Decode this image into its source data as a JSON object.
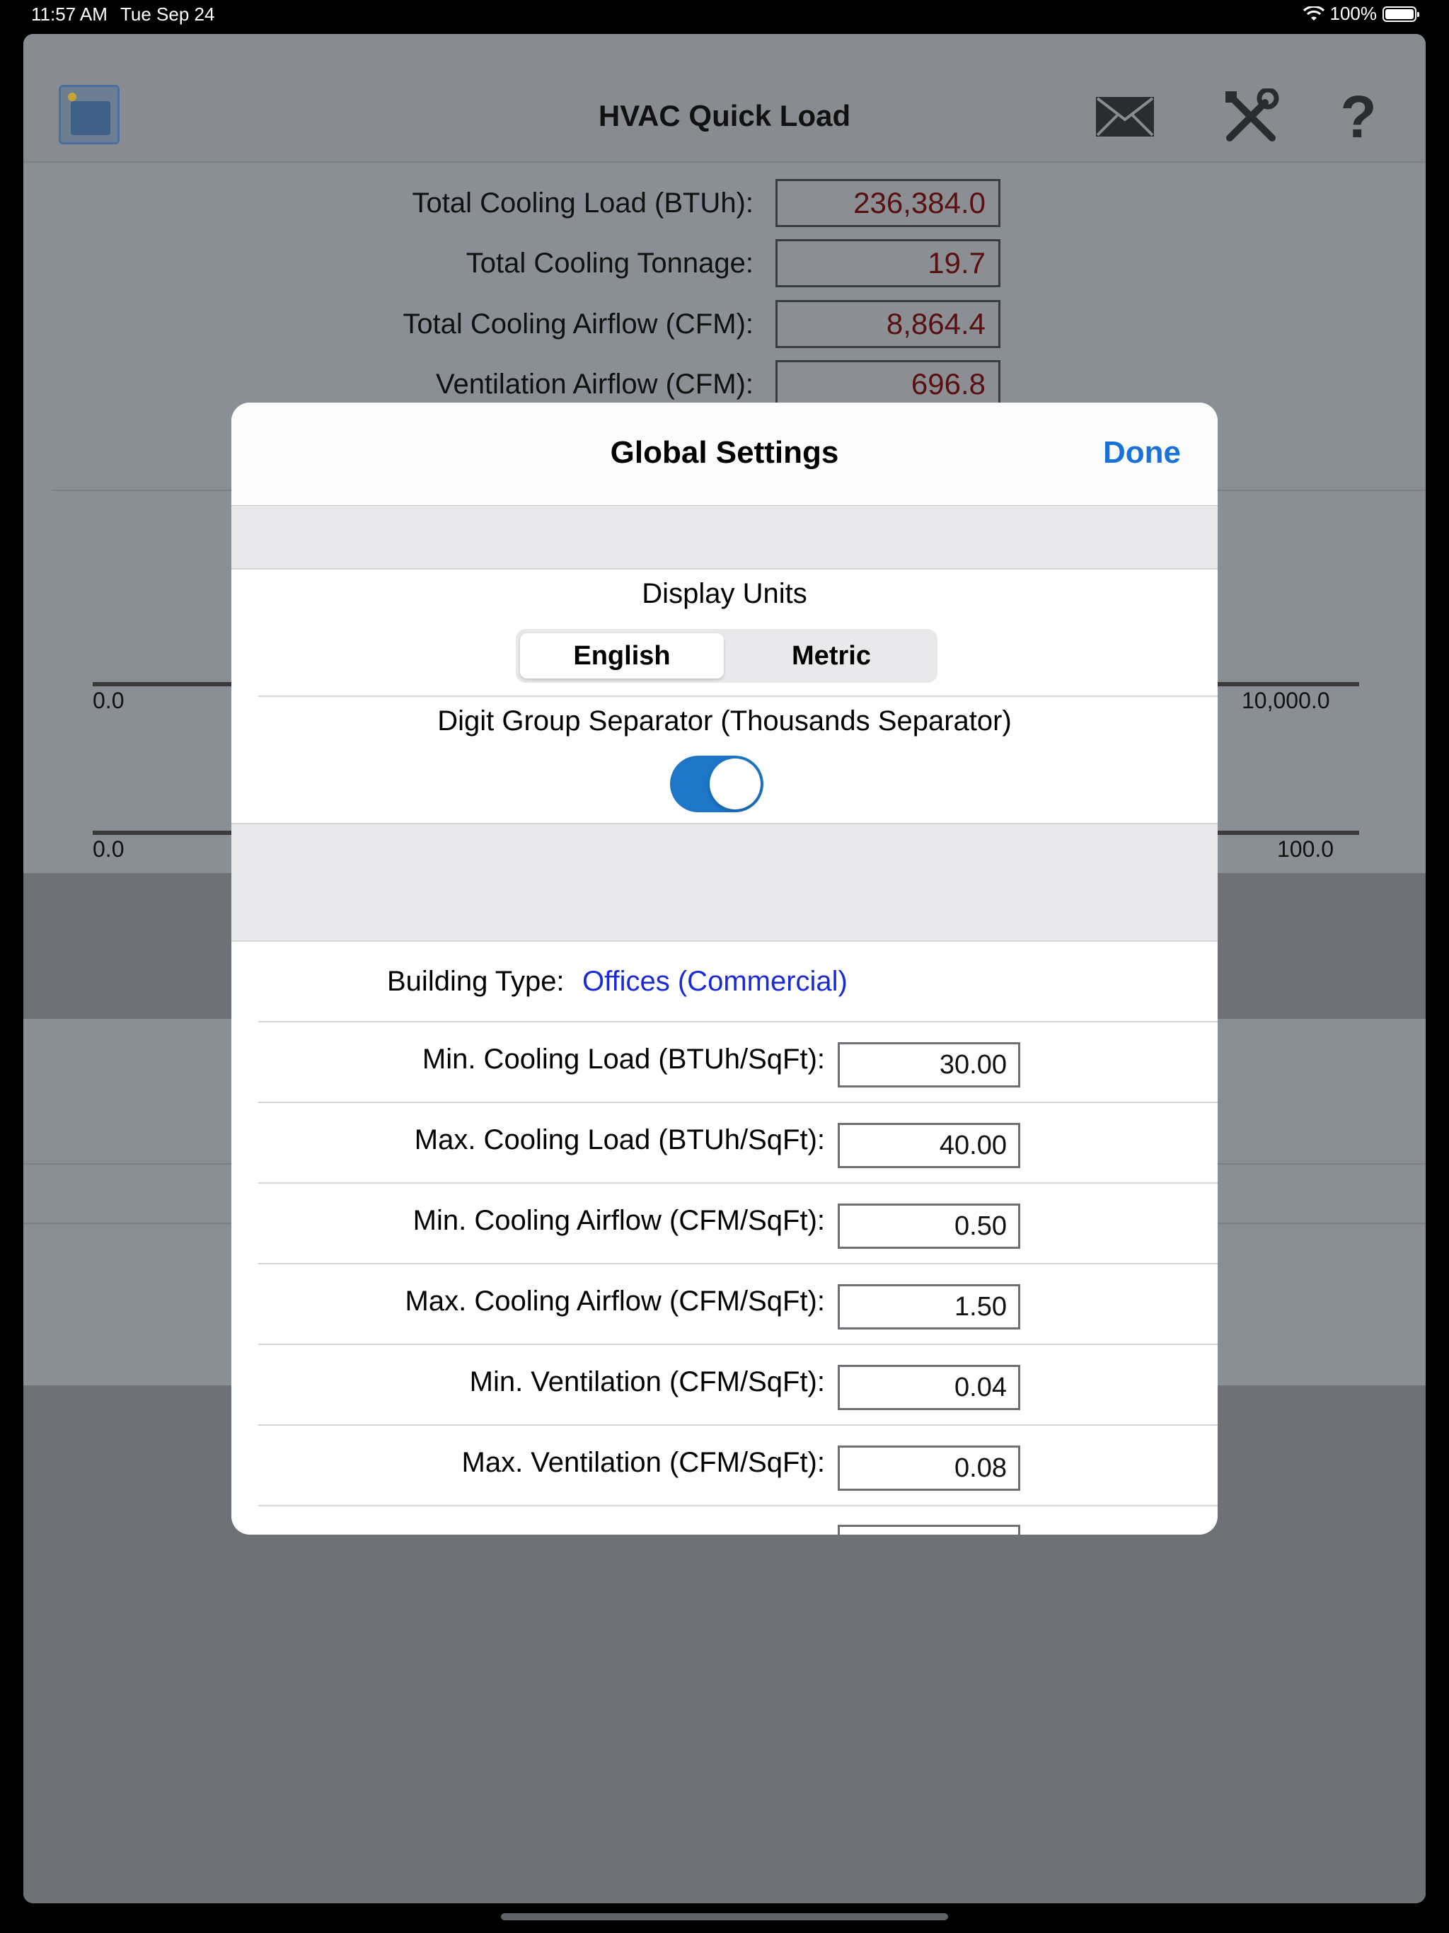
{
  "status_bar": {
    "time": "11:57 AM",
    "date": "Tue Sep 24",
    "battery": "100%"
  },
  "app": {
    "title": "HVAC Quick Load",
    "icons": {
      "logo": "building-icon",
      "mail": "mail-icon",
      "settings": "tools-icon",
      "help": "help-icon"
    },
    "results": [
      {
        "label": "Total Cooling Load (BTUh):",
        "value": "236,384.0"
      },
      {
        "label": "Total Cooling Tonnage:",
        "value": "19.7"
      },
      {
        "label": "Total Cooling Airflow (CFM):",
        "value": "8,864.4"
      },
      {
        "label": "Ventilation Airflow (CFM):",
        "value": "696.8"
      }
    ],
    "slider1": {
      "min": "0.0",
      "max": "10,000.0"
    },
    "slider2": {
      "min": "0.0",
      "max": "100.0"
    }
  },
  "modal": {
    "title": "Global Settings",
    "done_label": "Done",
    "display_units": {
      "label": "Display Units",
      "options": [
        "English",
        "Metric"
      ],
      "selected": "English"
    },
    "digit_separator": {
      "label": "Digit Group Separator (Thousands Separator)",
      "enabled": true
    },
    "building_type": {
      "label": "Building Type:",
      "value": "Offices (Commercial)"
    },
    "settings": [
      {
        "label": "Min. Cooling Load (BTUh/SqFt):",
        "value": "30.00"
      },
      {
        "label": "Max. Cooling Load (BTUh/SqFt):",
        "value": "40.00"
      },
      {
        "label": "Min. Cooling Airflow (CFM/SqFt):",
        "value": "0.50"
      },
      {
        "label": "Max. Cooling Airflow (CFM/SqFt):",
        "value": "1.50"
      },
      {
        "label": "Min. Ventilation (CFM/SqFt):",
        "value": "0.04"
      },
      {
        "label": "Max. Ventilation (CFM/SqFt):",
        "value": "0.08"
      }
    ]
  },
  "colors": {
    "accent": "#1a72d8",
    "link": "#1a2bd6",
    "toggle_on": "#1d76c8",
    "result_text": "#5a0f10"
  }
}
